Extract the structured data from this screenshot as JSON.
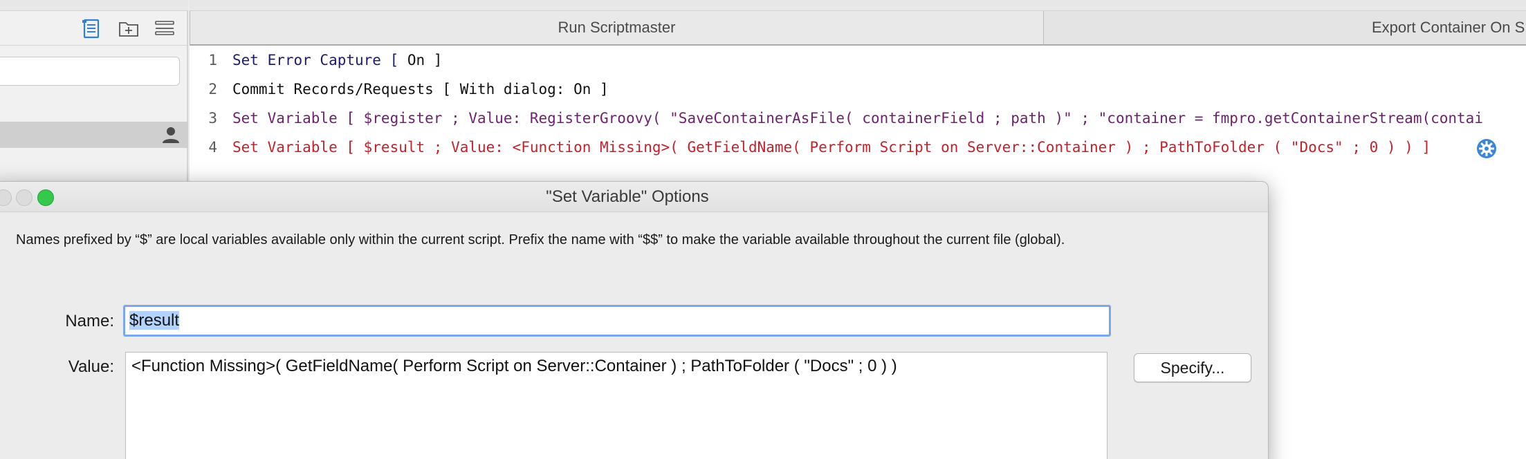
{
  "tabs": [
    {
      "label": "Run Scriptmaster"
    },
    {
      "label": "Export Container On S"
    }
  ],
  "script_lines": [
    {
      "num": "1",
      "parts": [
        {
          "text": "Set Error Capture [ ",
          "color": "#1c1c6e"
        },
        {
          "text": "On ]",
          "color": "#111111"
        }
      ]
    },
    {
      "num": "2",
      "parts": [
        {
          "text": "Commit Records/Requests [ With dialog: On ]",
          "color": "#111111"
        }
      ]
    },
    {
      "num": "3",
      "parts": [
        {
          "text": "Set Variable [ $register ; Value: RegisterGroovy( \"SaveContainerAsFile( containerField ; path )\" ; \"container = fmpro.getContainerStream(contai",
          "color": "#6e1f6e"
        }
      ]
    },
    {
      "num": "4",
      "parts": [
        {
          "text": "Set Variable [ $result ; Value: <Function Missing>( GetFieldName( Perform Script on Server::Container ) ; PathToFolder ( \"Docs\" ; 0 ) ) ]",
          "color": "#c6202a"
        }
      ]
    }
  ],
  "dialog": {
    "title": "\"Set Variable\" Options",
    "description": "Names prefixed by “$” are local variables available only within the current script. Prefix the name with “$$” to make the variable available throughout the current file (global).",
    "name_label": "Name:",
    "name_value": "$result",
    "value_label": "Value:",
    "value_text": "<Function Missing>( GetFieldName( Perform Script on Server::Container ) ; PathToFolder ( \"Docs\" ; 0 ) )",
    "specify_label": "Specify..."
  },
  "colors": {
    "accent_blue": "#3b86d8",
    "focus_ring": "#7aa7e7",
    "gear_blue": "#3b86d8",
    "zoom_green": "#35c84a"
  },
  "icons": {
    "toolbar": [
      "script-list-icon",
      "new-folder-icon",
      "menu-lines-icon"
    ],
    "selected_row": "person-icon",
    "line4_marker": "gear-icon"
  }
}
